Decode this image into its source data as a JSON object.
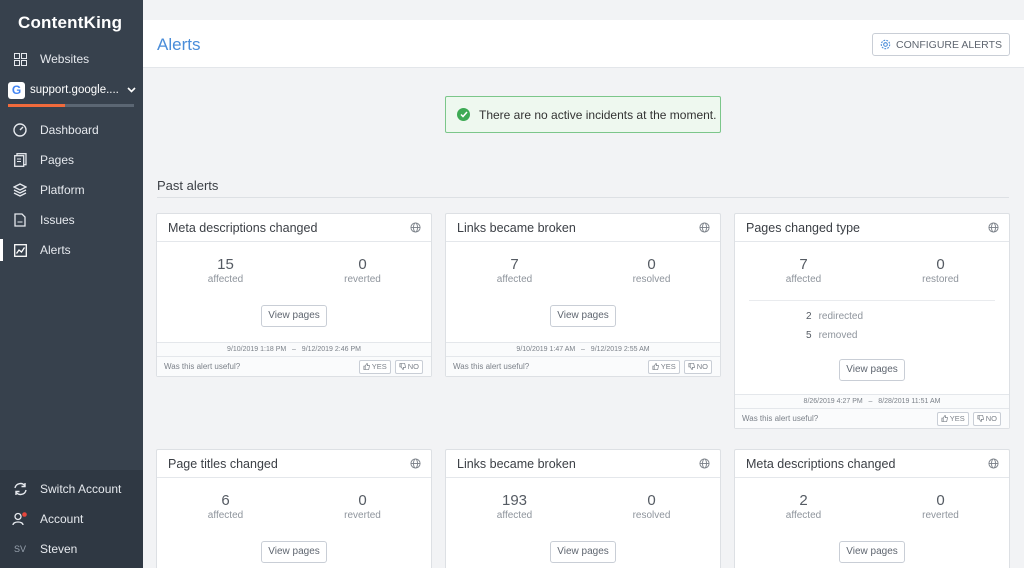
{
  "sidebar": {
    "logo": "ContentKing",
    "websites_label": "Websites",
    "site_name": "support.google....",
    "site_progress": 0.45,
    "items": [
      {
        "label": "Dashboard",
        "icon": "gauge-icon"
      },
      {
        "label": "Pages",
        "icon": "pages-icon"
      },
      {
        "label": "Platform",
        "icon": "platform-layers-icon"
      },
      {
        "label": "Issues",
        "icon": "issues-document-icon"
      },
      {
        "label": "Alerts",
        "icon": "alerts-chart-icon",
        "active": true
      }
    ],
    "bottom": {
      "switch_account": "Switch Account",
      "account": "Account",
      "user_initials": "SV",
      "user_name": "Steven"
    }
  },
  "header": {
    "title": "Alerts",
    "configure_label": "CONFIGURE ALERTS"
  },
  "notice": {
    "text": "There are no active incidents at the moment."
  },
  "past_alerts": {
    "title": "Past alerts",
    "feedback_question": "Was this alert useful?",
    "yes_label": "YES",
    "no_label": "NO",
    "view_pages_label": "View pages",
    "cards": [
      {
        "title": "Meta descriptions changed",
        "stat1": "15",
        "stat1_label": "affected",
        "stat2": "0",
        "stat2_label": "reverted",
        "date_from": "9/10/2019 1:18 PM",
        "date_to": "9/12/2019 2:46 PM"
      },
      {
        "title": "Links became broken",
        "stat1": "7",
        "stat1_label": "affected",
        "stat2": "0",
        "stat2_label": "resolved",
        "date_from": "9/10/2019 1:47 AM",
        "date_to": "9/12/2019 2:55 AM"
      },
      {
        "title": "Pages changed type",
        "stat1": "7",
        "stat1_label": "affected",
        "stat2": "0",
        "stat2_label": "restored",
        "breakdown": [
          {
            "n": "2",
            "label": "redirected"
          },
          {
            "n": "5",
            "label": "removed"
          }
        ],
        "date_from": "8/26/2019 4:27 PM",
        "date_to": "8/28/2019 11:51 AM"
      },
      {
        "title": "Page titles changed",
        "stat1": "6",
        "stat1_label": "affected",
        "stat2": "0",
        "stat2_label": "reverted"
      },
      {
        "title": "Links became broken",
        "stat1": "193",
        "stat1_label": "affected",
        "stat2": "0",
        "stat2_label": "resolved"
      },
      {
        "title": "Meta descriptions changed",
        "stat1": "2",
        "stat1_label": "affected",
        "stat2": "0",
        "stat2_label": "reverted"
      }
    ],
    "date_separator": "–"
  }
}
